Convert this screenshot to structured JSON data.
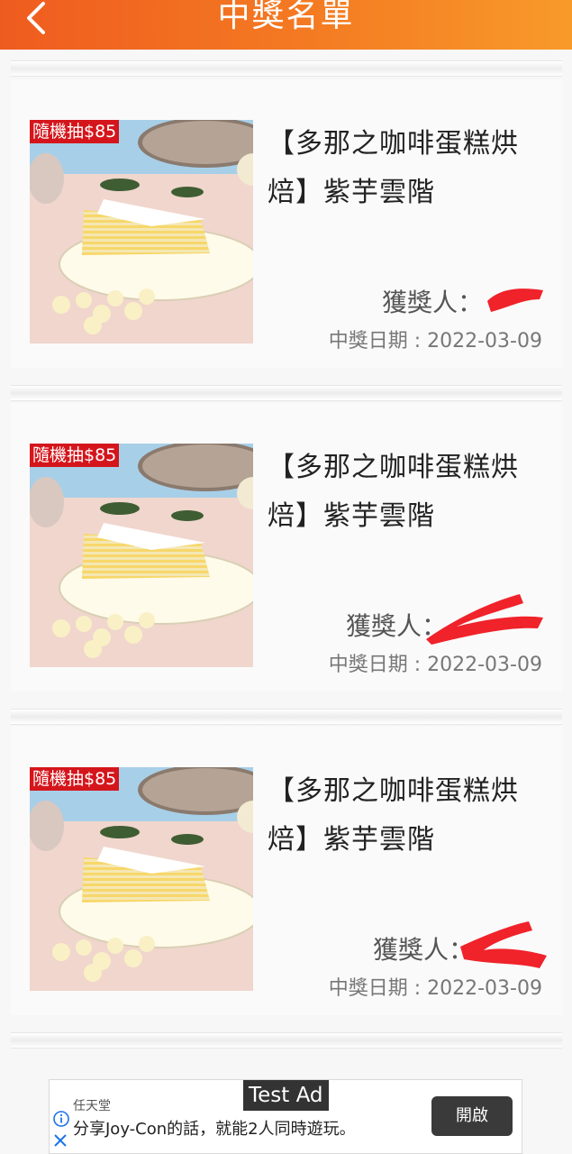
{
  "header": {
    "title": "中獎名單",
    "back_icon": "chevron-left-icon",
    "color_start": "#ef5b1f",
    "color_end": "#f89a2a"
  },
  "winners": [
    {
      "badge": "隨機抽$85",
      "title": "【多那之咖啡蛋糕烘焙】紫芋雲階",
      "winner_label": "獲獎人：",
      "date_label": "中獎日期 : 2022-03-09"
    },
    {
      "badge": "隨機抽$85",
      "title": "【多那之咖啡蛋糕烘焙】紫芋雲階",
      "winner_label": "獲獎人：",
      "date_label": "中獎日期 : 2022-03-09"
    },
    {
      "badge": "隨機抽$85",
      "title": "【多那之咖啡蛋糕烘焙】紫芋雲階",
      "winner_label": "獲獎人：",
      "date_label": "中獎日期 : 2022-03-09"
    }
  ],
  "ad": {
    "label": "Test Ad",
    "advertiser": "任天堂",
    "text": "分享Joy-Con的話，就能2人同時遊玩。",
    "cta": "開啟",
    "info_icon": "info-icon",
    "close_icon": "close-icon"
  },
  "colors": {
    "badge": "#d4161c",
    "redaction": "#f0222a"
  }
}
